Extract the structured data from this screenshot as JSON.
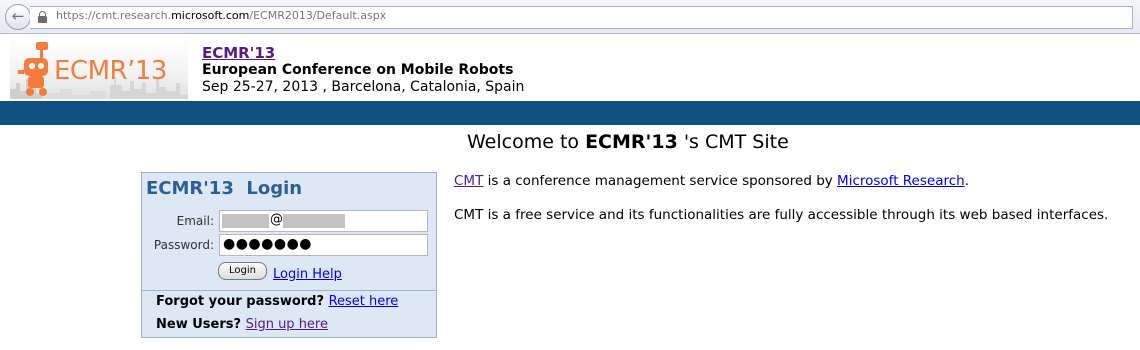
{
  "browser": {
    "back_icon": "arrow-left-icon",
    "lock_icon": "lock-icon",
    "url_prefix": "https://cmt.research.",
    "url_domain": "microsoft.com",
    "url_path": "/ECMR2013/Default.aspx"
  },
  "header": {
    "logo_text": "ECMR’13",
    "conf_short": "ECMR'13",
    "conf_full": "European Conference on Mobile Robots",
    "conf_date": "Sep 25-27, 2013 , Barcelona, Catalonia, Spain",
    "band_color": "#0f5080",
    "logo_color": "#f47c3c"
  },
  "welcome": {
    "prefix": "Welcome to ",
    "conf": "ECMR'13",
    "suffix": " 's CMT Site"
  },
  "login": {
    "title": "ECMR'13  Login",
    "email_label": "Email:",
    "email_at": "@",
    "password_label": "Password:",
    "password_value": "●●●●●●●",
    "login_button": "Login",
    "login_help": "Login Help",
    "forgot_text": "Forgot your password?",
    "reset_link": "Reset here",
    "new_users_text": "New Users?",
    "signup_link": "Sign up here"
  },
  "info": {
    "cmt_link": "CMT",
    "line1_mid": " is a conference management service sponsored by ",
    "msr_link": "Microsoft Research",
    "line1_end": ".",
    "line2": "CMT is a free service and its functionalities are fully accessible through its web based interfaces."
  }
}
